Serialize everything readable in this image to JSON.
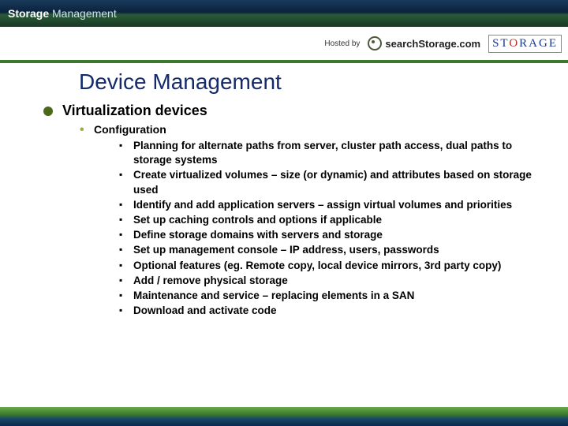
{
  "header": {
    "logo_bold": "Storage",
    "logo_light": "Management",
    "hosted_by": "Hosted by",
    "search_text": "searchStorage.com",
    "storage_box": "STORAGE"
  },
  "title": "Device Management",
  "l1_item": "Virtualization devices",
  "l2_item": "Configuration",
  "l3": [
    "Planning for alternate paths from server, cluster path access, dual paths to storage systems",
    "Create virtualized volumes – size (or dynamic) and attributes based on storage used",
    "Identify and add application servers – assign virtual volumes and priorities",
    "Set up caching controls and options if applicable",
    "Define storage domains with servers and storage",
    "Set up management console – IP address, users, passwords",
    "Optional features (eg. Remote copy, local device mirrors, 3rd party copy)",
    "Add / remove physical storage",
    "Maintenance and service – replacing elements in a SAN",
    "Download and activate code"
  ]
}
